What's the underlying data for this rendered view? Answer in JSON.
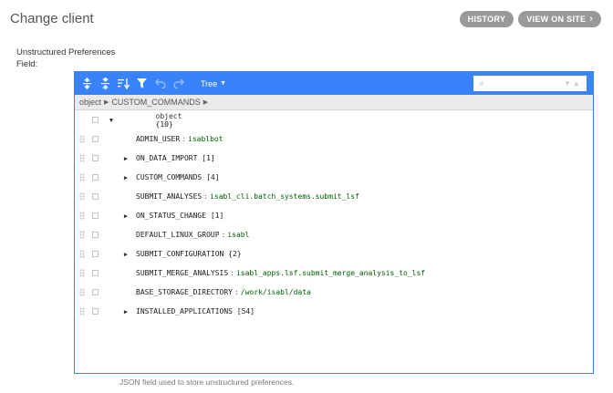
{
  "page": {
    "title": "Change client",
    "history_label": "HISTORY",
    "view_on_site_label": "VIEW ON SITE",
    "field_label": "Unstructured Preferences Field:",
    "help_text": "JSON field used to store unstructured preferences."
  },
  "editor": {
    "mode_label": "Tree",
    "accent_color": "#3883fa",
    "search_placeholder": "",
    "breadcrumb": [
      "object",
      "CUSTOM_COMMANDS"
    ],
    "root_label": "object",
    "root_count": "{10}",
    "rows": [
      {
        "key": "ADMIN_USER",
        "value": "isablbot",
        "type": "string"
      },
      {
        "key": "ON_DATA_IMPORT",
        "count": "[1]",
        "type": "array"
      },
      {
        "key": "CUSTOM_COMMANDS",
        "count": "[4]",
        "type": "array"
      },
      {
        "key": "SUBMIT_ANALYSES",
        "value": "isabl_cli.batch_systems.submit_lsf",
        "type": "string"
      },
      {
        "key": "ON_STATUS_CHANGE",
        "count": "[1]",
        "type": "array"
      },
      {
        "key": "DEFAULT_LINUX_GROUP",
        "value": "isabl",
        "type": "string"
      },
      {
        "key": "SUBMIT_CONFIGURATION",
        "count": "{2}",
        "type": "object"
      },
      {
        "key": "SUBMIT_MERGE_ANALYSIS",
        "value": "isabl_apps.lsf.submit_merge_analysis_to_lsf",
        "type": "string"
      },
      {
        "key": "BASE_STORAGE_DIRECTORY",
        "value": "/work/isabl/data",
        "type": "string"
      },
      {
        "key": "INSTALLED_APPLICATIONS",
        "count": "[54]",
        "type": "array"
      }
    ]
  }
}
